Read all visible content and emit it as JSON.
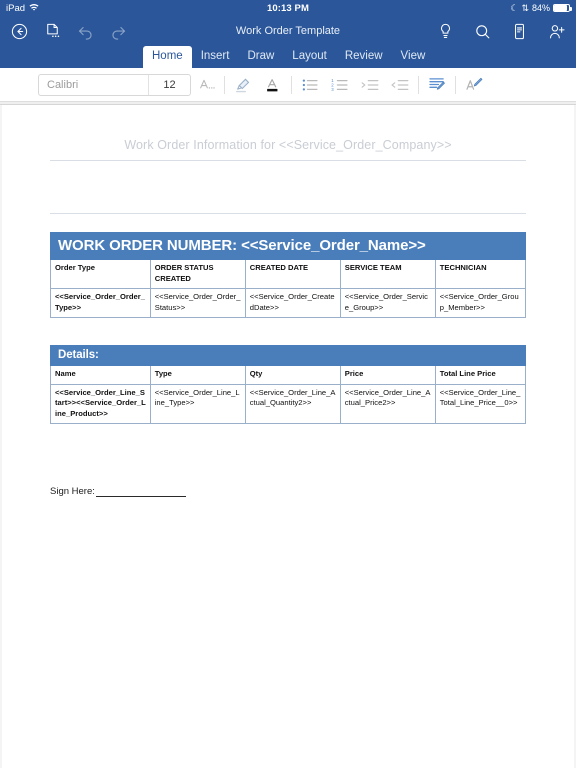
{
  "status_bar": {
    "device": "iPad",
    "wifi_icon": "wifi-icon",
    "time": "10:13 PM",
    "moon_icon": "moon-icon",
    "bluetooth_icon": "bluetooth-icon",
    "battery_percent": "84%",
    "battery_level": 84
  },
  "title_bar": {
    "back_icon": "back-arrow-circle-icon",
    "file_icon": "file-options-icon",
    "undo_icon": "undo-icon",
    "redo_icon": "redo-icon",
    "title": "Work Order Template",
    "tell_me_icon": "lightbulb-icon",
    "search_icon": "search-icon",
    "read_mode_icon": "mobile-view-icon",
    "share_icon": "add-person-icon"
  },
  "ribbon": {
    "tabs": [
      {
        "label": "Home",
        "active": true
      },
      {
        "label": "Insert",
        "active": false
      },
      {
        "label": "Draw",
        "active": false
      },
      {
        "label": "Layout",
        "active": false
      },
      {
        "label": "Review",
        "active": false
      },
      {
        "label": "View",
        "active": false
      }
    ],
    "font_name": "Calibri",
    "font_size": "12",
    "tools": [
      {
        "name": "font-formatting-icon"
      },
      {
        "name": "highlight-color-icon"
      },
      {
        "name": "font-color-icon"
      },
      {
        "name": "bullet-list-icon"
      },
      {
        "name": "numbered-list-icon"
      },
      {
        "name": "decrease-indent-icon"
      },
      {
        "name": "increase-indent-icon"
      },
      {
        "name": "paragraph-styles-icon"
      },
      {
        "name": "format-painter-icon"
      }
    ]
  },
  "document": {
    "header_text": "Work Order Information for <<Service_Order_Company>>",
    "work_order_table": {
      "banner": "WORK ORDER NUMBER: <<Service_Order_Name>>",
      "headers": [
        "Order Type",
        "ORDER STATUS CREATED",
        "CREATED DATE",
        "SERVICE TEAM",
        "TECHNICIAN"
      ],
      "row": [
        "<<Service_Order_Order_Type>>",
        "<<Service_Order_Order_Status>>",
        "<<Service_Order_CreatedDate>>",
        "<<Service_Order_Service_Group>>",
        "<<Service_Order_Group_Member>>"
      ]
    },
    "details_table": {
      "banner": "Details:",
      "headers": [
        "Name",
        "Type",
        "Qty",
        "Price",
        "Total Line Price"
      ],
      "row": [
        "<<Service_Order_Line_Start>><<Service_Order_Line_Product>>",
        "<<Service_Order_Line_Line_Type>>",
        "<<Service_Order_Line_Actual_Quantity2>>",
        "<<Service_Order_Line_Actual_Price2>>",
        "<<Service_Order_Line_Total_Line_Price__0>>"
      ]
    },
    "sign_here_label": "Sign Here:"
  },
  "colors": {
    "chrome_blue": "#2b579a",
    "table_blue": "#4a7ebb",
    "table_border": "#9aafc9",
    "header_gray": "#c9cdd4"
  }
}
